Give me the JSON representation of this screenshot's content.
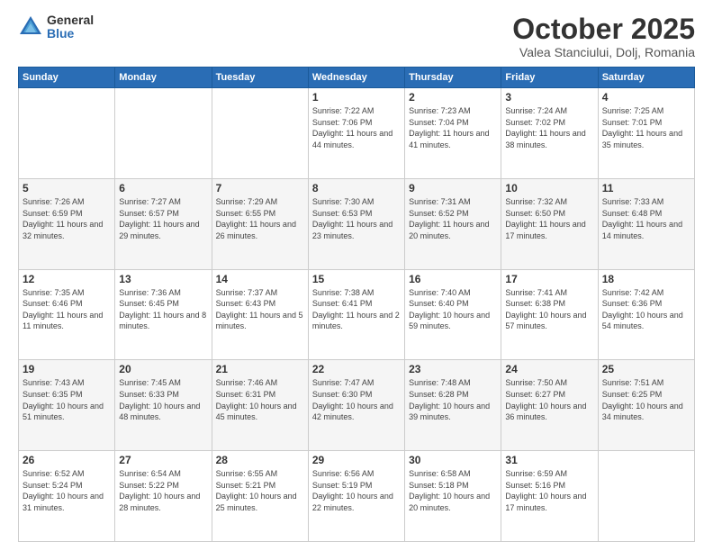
{
  "header": {
    "logo_general": "General",
    "logo_blue": "Blue",
    "title": "October 2025",
    "subtitle": "Valea Stanciului, Dolj, Romania"
  },
  "days_of_week": [
    "Sunday",
    "Monday",
    "Tuesday",
    "Wednesday",
    "Thursday",
    "Friday",
    "Saturday"
  ],
  "weeks": [
    [
      {
        "day": "",
        "info": ""
      },
      {
        "day": "",
        "info": ""
      },
      {
        "day": "",
        "info": ""
      },
      {
        "day": "1",
        "info": "Sunrise: 7:22 AM\nSunset: 7:06 PM\nDaylight: 11 hours\nand 44 minutes."
      },
      {
        "day": "2",
        "info": "Sunrise: 7:23 AM\nSunset: 7:04 PM\nDaylight: 11 hours\nand 41 minutes."
      },
      {
        "day": "3",
        "info": "Sunrise: 7:24 AM\nSunset: 7:02 PM\nDaylight: 11 hours\nand 38 minutes."
      },
      {
        "day": "4",
        "info": "Sunrise: 7:25 AM\nSunset: 7:01 PM\nDaylight: 11 hours\nand 35 minutes."
      }
    ],
    [
      {
        "day": "5",
        "info": "Sunrise: 7:26 AM\nSunset: 6:59 PM\nDaylight: 11 hours\nand 32 minutes."
      },
      {
        "day": "6",
        "info": "Sunrise: 7:27 AM\nSunset: 6:57 PM\nDaylight: 11 hours\nand 29 minutes."
      },
      {
        "day": "7",
        "info": "Sunrise: 7:29 AM\nSunset: 6:55 PM\nDaylight: 11 hours\nand 26 minutes."
      },
      {
        "day": "8",
        "info": "Sunrise: 7:30 AM\nSunset: 6:53 PM\nDaylight: 11 hours\nand 23 minutes."
      },
      {
        "day": "9",
        "info": "Sunrise: 7:31 AM\nSunset: 6:52 PM\nDaylight: 11 hours\nand 20 minutes."
      },
      {
        "day": "10",
        "info": "Sunrise: 7:32 AM\nSunset: 6:50 PM\nDaylight: 11 hours\nand 17 minutes."
      },
      {
        "day": "11",
        "info": "Sunrise: 7:33 AM\nSunset: 6:48 PM\nDaylight: 11 hours\nand 14 minutes."
      }
    ],
    [
      {
        "day": "12",
        "info": "Sunrise: 7:35 AM\nSunset: 6:46 PM\nDaylight: 11 hours\nand 11 minutes."
      },
      {
        "day": "13",
        "info": "Sunrise: 7:36 AM\nSunset: 6:45 PM\nDaylight: 11 hours\nand 8 minutes."
      },
      {
        "day": "14",
        "info": "Sunrise: 7:37 AM\nSunset: 6:43 PM\nDaylight: 11 hours\nand 5 minutes."
      },
      {
        "day": "15",
        "info": "Sunrise: 7:38 AM\nSunset: 6:41 PM\nDaylight: 11 hours\nand 2 minutes."
      },
      {
        "day": "16",
        "info": "Sunrise: 7:40 AM\nSunset: 6:40 PM\nDaylight: 10 hours\nand 59 minutes."
      },
      {
        "day": "17",
        "info": "Sunrise: 7:41 AM\nSunset: 6:38 PM\nDaylight: 10 hours\nand 57 minutes."
      },
      {
        "day": "18",
        "info": "Sunrise: 7:42 AM\nSunset: 6:36 PM\nDaylight: 10 hours\nand 54 minutes."
      }
    ],
    [
      {
        "day": "19",
        "info": "Sunrise: 7:43 AM\nSunset: 6:35 PM\nDaylight: 10 hours\nand 51 minutes."
      },
      {
        "day": "20",
        "info": "Sunrise: 7:45 AM\nSunset: 6:33 PM\nDaylight: 10 hours\nand 48 minutes."
      },
      {
        "day": "21",
        "info": "Sunrise: 7:46 AM\nSunset: 6:31 PM\nDaylight: 10 hours\nand 45 minutes."
      },
      {
        "day": "22",
        "info": "Sunrise: 7:47 AM\nSunset: 6:30 PM\nDaylight: 10 hours\nand 42 minutes."
      },
      {
        "day": "23",
        "info": "Sunrise: 7:48 AM\nSunset: 6:28 PM\nDaylight: 10 hours\nand 39 minutes."
      },
      {
        "day": "24",
        "info": "Sunrise: 7:50 AM\nSunset: 6:27 PM\nDaylight: 10 hours\nand 36 minutes."
      },
      {
        "day": "25",
        "info": "Sunrise: 7:51 AM\nSunset: 6:25 PM\nDaylight: 10 hours\nand 34 minutes."
      }
    ],
    [
      {
        "day": "26",
        "info": "Sunrise: 6:52 AM\nSunset: 5:24 PM\nDaylight: 10 hours\nand 31 minutes."
      },
      {
        "day": "27",
        "info": "Sunrise: 6:54 AM\nSunset: 5:22 PM\nDaylight: 10 hours\nand 28 minutes."
      },
      {
        "day": "28",
        "info": "Sunrise: 6:55 AM\nSunset: 5:21 PM\nDaylight: 10 hours\nand 25 minutes."
      },
      {
        "day": "29",
        "info": "Sunrise: 6:56 AM\nSunset: 5:19 PM\nDaylight: 10 hours\nand 22 minutes."
      },
      {
        "day": "30",
        "info": "Sunrise: 6:58 AM\nSunset: 5:18 PM\nDaylight: 10 hours\nand 20 minutes."
      },
      {
        "day": "31",
        "info": "Sunrise: 6:59 AM\nSunset: 5:16 PM\nDaylight: 10 hours\nand 17 minutes."
      },
      {
        "day": "",
        "info": ""
      }
    ]
  ]
}
